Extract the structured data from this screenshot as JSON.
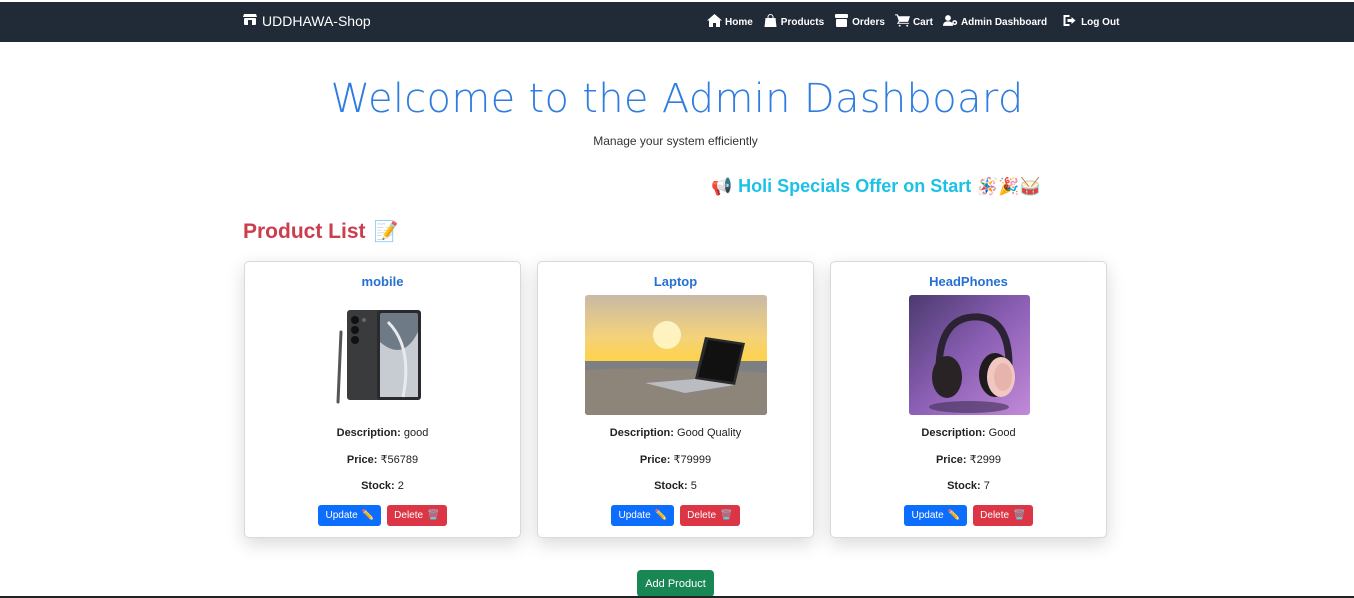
{
  "brand": {
    "name": "UDDHAWA-Shop",
    "icon": "store-icon"
  },
  "nav": {
    "items": [
      {
        "label": "Home",
        "icon": "home-icon"
      },
      {
        "label": "Products",
        "icon": "bag-icon"
      },
      {
        "label": "Orders",
        "icon": "box-icon"
      },
      {
        "label": "Cart",
        "icon": "cart-icon"
      },
      {
        "label": "Admin Dashboard",
        "icon": "user-gear-icon"
      },
      {
        "label": "Log Out",
        "icon": "logout-icon"
      }
    ]
  },
  "hero": {
    "title": "Welcome to the Admin Dashboard",
    "subtitle": "Manage your system efficiently"
  },
  "promo": {
    "text": "Holi Specials Offer on Start",
    "lead_emoji": "📢",
    "trail_emoji": "🪅🎉🥁"
  },
  "product_list": {
    "title": "Product List",
    "title_emoji": "📝",
    "products": [
      {
        "name": "mobile",
        "image": "phone-image",
        "description_label": "Description:",
        "description": "good",
        "price_label": "Price:",
        "price": "₹56789",
        "stock_label": "Stock:",
        "stock": "2"
      },
      {
        "name": "Laptop",
        "image": "laptop-beach-image",
        "description_label": "Description:",
        "description": "Good Quality",
        "price_label": "Price:",
        "price": "₹79999",
        "stock_label": "Stock:",
        "stock": "5"
      },
      {
        "name": "HeadPhones",
        "image": "headphones-image",
        "description_label": "Description:",
        "description": "Good",
        "price_label": "Price:",
        "price": "₹2999",
        "stock_label": "Stock:",
        "stock": "7"
      }
    ],
    "update_label": "Update",
    "delete_label": "Delete",
    "update_emoji": "✏️",
    "delete_emoji": "🗑️"
  },
  "add_button": {
    "label": "Add Product"
  },
  "colors": {
    "navbar": "#212a37",
    "hero": "#2f7de1",
    "promo": "#1bc1e6",
    "section": "#cc3d4d",
    "update": "#0d6efd",
    "delete": "#dc3545",
    "add": "#198754"
  }
}
